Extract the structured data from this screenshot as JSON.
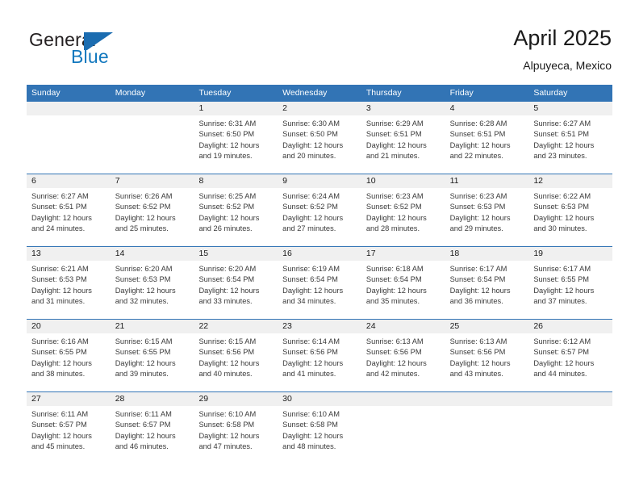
{
  "brand": {
    "name_part1": "General",
    "name_part2": "Blue",
    "mark": "triangle-flag-logo"
  },
  "header": {
    "title": "April 2025",
    "subtitle": "Alpuyeca, Mexico"
  },
  "weekday_headers": [
    "Sunday",
    "Monday",
    "Tuesday",
    "Wednesday",
    "Thursday",
    "Friday",
    "Saturday"
  ],
  "colors": {
    "header_blue": "#3274b5",
    "brand_blue": "#1278be",
    "number_band": "#f0f0f0",
    "text": "#1a1a1a"
  },
  "weeks": [
    {
      "days": [
        {
          "number": "",
          "lines": []
        },
        {
          "number": "",
          "lines": []
        },
        {
          "number": "1",
          "lines": [
            "Sunrise: 6:31 AM",
            "Sunset: 6:50 PM",
            "Daylight: 12 hours",
            "and 19 minutes."
          ]
        },
        {
          "number": "2",
          "lines": [
            "Sunrise: 6:30 AM",
            "Sunset: 6:50 PM",
            "Daylight: 12 hours",
            "and 20 minutes."
          ]
        },
        {
          "number": "3",
          "lines": [
            "Sunrise: 6:29 AM",
            "Sunset: 6:51 PM",
            "Daylight: 12 hours",
            "and 21 minutes."
          ]
        },
        {
          "number": "4",
          "lines": [
            "Sunrise: 6:28 AM",
            "Sunset: 6:51 PM",
            "Daylight: 12 hours",
            "and 22 minutes."
          ]
        },
        {
          "number": "5",
          "lines": [
            "Sunrise: 6:27 AM",
            "Sunset: 6:51 PM",
            "Daylight: 12 hours",
            "and 23 minutes."
          ]
        }
      ]
    },
    {
      "days": [
        {
          "number": "6",
          "lines": [
            "Sunrise: 6:27 AM",
            "Sunset: 6:51 PM",
            "Daylight: 12 hours",
            "and 24 minutes."
          ]
        },
        {
          "number": "7",
          "lines": [
            "Sunrise: 6:26 AM",
            "Sunset: 6:52 PM",
            "Daylight: 12 hours",
            "and 25 minutes."
          ]
        },
        {
          "number": "8",
          "lines": [
            "Sunrise: 6:25 AM",
            "Sunset: 6:52 PM",
            "Daylight: 12 hours",
            "and 26 minutes."
          ]
        },
        {
          "number": "9",
          "lines": [
            "Sunrise: 6:24 AM",
            "Sunset: 6:52 PM",
            "Daylight: 12 hours",
            "and 27 minutes."
          ]
        },
        {
          "number": "10",
          "lines": [
            "Sunrise: 6:23 AM",
            "Sunset: 6:52 PM",
            "Daylight: 12 hours",
            "and 28 minutes."
          ]
        },
        {
          "number": "11",
          "lines": [
            "Sunrise: 6:23 AM",
            "Sunset: 6:53 PM",
            "Daylight: 12 hours",
            "and 29 minutes."
          ]
        },
        {
          "number": "12",
          "lines": [
            "Sunrise: 6:22 AM",
            "Sunset: 6:53 PM",
            "Daylight: 12 hours",
            "and 30 minutes."
          ]
        }
      ]
    },
    {
      "days": [
        {
          "number": "13",
          "lines": [
            "Sunrise: 6:21 AM",
            "Sunset: 6:53 PM",
            "Daylight: 12 hours",
            "and 31 minutes."
          ]
        },
        {
          "number": "14",
          "lines": [
            "Sunrise: 6:20 AM",
            "Sunset: 6:53 PM",
            "Daylight: 12 hours",
            "and 32 minutes."
          ]
        },
        {
          "number": "15",
          "lines": [
            "Sunrise: 6:20 AM",
            "Sunset: 6:54 PM",
            "Daylight: 12 hours",
            "and 33 minutes."
          ]
        },
        {
          "number": "16",
          "lines": [
            "Sunrise: 6:19 AM",
            "Sunset: 6:54 PM",
            "Daylight: 12 hours",
            "and 34 minutes."
          ]
        },
        {
          "number": "17",
          "lines": [
            "Sunrise: 6:18 AM",
            "Sunset: 6:54 PM",
            "Daylight: 12 hours",
            "and 35 minutes."
          ]
        },
        {
          "number": "18",
          "lines": [
            "Sunrise: 6:17 AM",
            "Sunset: 6:54 PM",
            "Daylight: 12 hours",
            "and 36 minutes."
          ]
        },
        {
          "number": "19",
          "lines": [
            "Sunrise: 6:17 AM",
            "Sunset: 6:55 PM",
            "Daylight: 12 hours",
            "and 37 minutes."
          ]
        }
      ]
    },
    {
      "days": [
        {
          "number": "20",
          "lines": [
            "Sunrise: 6:16 AM",
            "Sunset: 6:55 PM",
            "Daylight: 12 hours",
            "and 38 minutes."
          ]
        },
        {
          "number": "21",
          "lines": [
            "Sunrise: 6:15 AM",
            "Sunset: 6:55 PM",
            "Daylight: 12 hours",
            "and 39 minutes."
          ]
        },
        {
          "number": "22",
          "lines": [
            "Sunrise: 6:15 AM",
            "Sunset: 6:56 PM",
            "Daylight: 12 hours",
            "and 40 minutes."
          ]
        },
        {
          "number": "23",
          "lines": [
            "Sunrise: 6:14 AM",
            "Sunset: 6:56 PM",
            "Daylight: 12 hours",
            "and 41 minutes."
          ]
        },
        {
          "number": "24",
          "lines": [
            "Sunrise: 6:13 AM",
            "Sunset: 6:56 PM",
            "Daylight: 12 hours",
            "and 42 minutes."
          ]
        },
        {
          "number": "25",
          "lines": [
            "Sunrise: 6:13 AM",
            "Sunset: 6:56 PM",
            "Daylight: 12 hours",
            "and 43 minutes."
          ]
        },
        {
          "number": "26",
          "lines": [
            "Sunrise: 6:12 AM",
            "Sunset: 6:57 PM",
            "Daylight: 12 hours",
            "and 44 minutes."
          ]
        }
      ]
    },
    {
      "days": [
        {
          "number": "27",
          "lines": [
            "Sunrise: 6:11 AM",
            "Sunset: 6:57 PM",
            "Daylight: 12 hours",
            "and 45 minutes."
          ]
        },
        {
          "number": "28",
          "lines": [
            "Sunrise: 6:11 AM",
            "Sunset: 6:57 PM",
            "Daylight: 12 hours",
            "and 46 minutes."
          ]
        },
        {
          "number": "29",
          "lines": [
            "Sunrise: 6:10 AM",
            "Sunset: 6:58 PM",
            "Daylight: 12 hours",
            "and 47 minutes."
          ]
        },
        {
          "number": "30",
          "lines": [
            "Sunrise: 6:10 AM",
            "Sunset: 6:58 PM",
            "Daylight: 12 hours",
            "and 48 minutes."
          ]
        },
        {
          "number": "",
          "lines": []
        },
        {
          "number": "",
          "lines": []
        },
        {
          "number": "",
          "lines": []
        }
      ]
    }
  ]
}
